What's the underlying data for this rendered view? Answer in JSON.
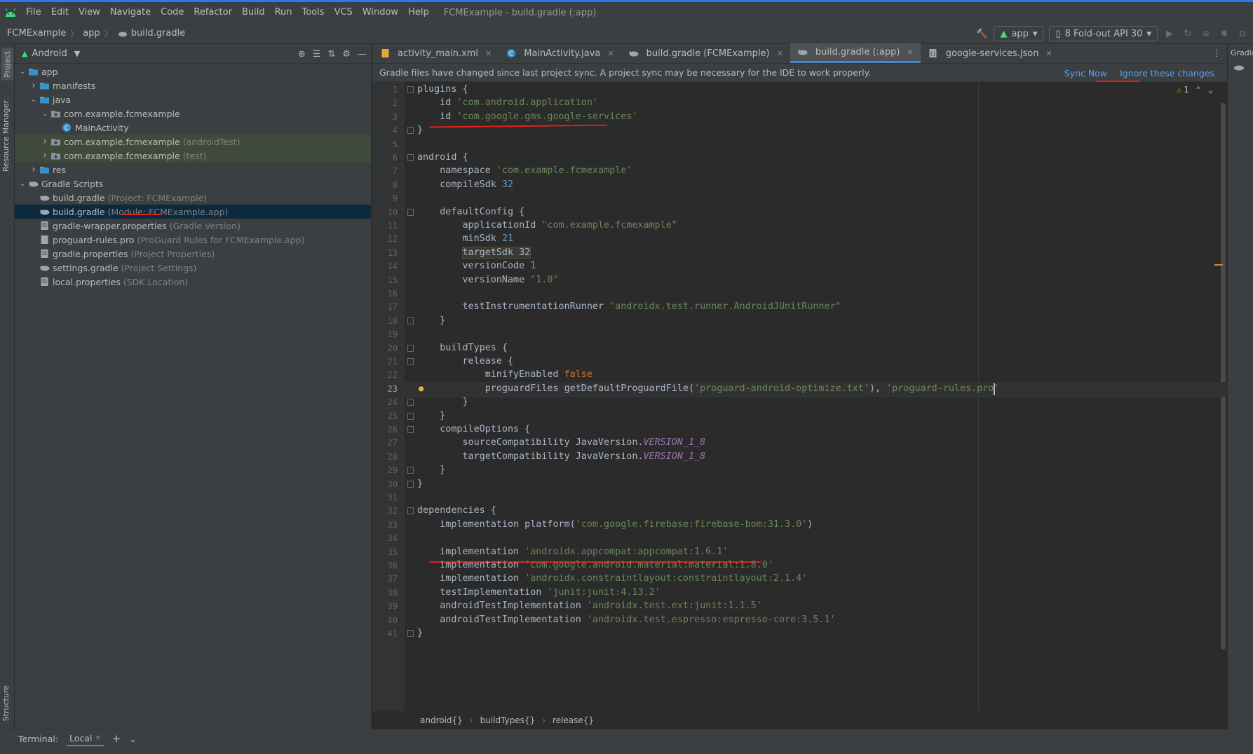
{
  "window": {
    "title": "FCMExample - build.gradle (:app)"
  },
  "menu": [
    "File",
    "Edit",
    "View",
    "Navigate",
    "Code",
    "Refactor",
    "Build",
    "Run",
    "Tools",
    "VCS",
    "Window",
    "Help"
  ],
  "navbar": {
    "crumbs": [
      "FCMExample",
      "app",
      "build.gradle"
    ],
    "run_config": "app",
    "device": "8  Fold-out API 30"
  },
  "side_tabs": {
    "project": "Project",
    "resource_manager": "Resource Manager",
    "structure": "Structure",
    "gradle": "Gradle"
  },
  "project_panel": {
    "view_mode": "Android",
    "tree": [
      {
        "label": "app",
        "hint": "",
        "indent": 0,
        "arrow": "down",
        "icon": "folder-icon"
      },
      {
        "label": "manifests",
        "hint": "",
        "indent": 1,
        "arrow": "right",
        "icon": "folder-icon"
      },
      {
        "label": "java",
        "hint": "",
        "indent": 1,
        "arrow": "down",
        "icon": "folder-icon"
      },
      {
        "label": "com.example.fcmexample",
        "hint": "",
        "indent": 2,
        "arrow": "down",
        "icon": "package-icon"
      },
      {
        "label": "MainActivity",
        "hint": "",
        "indent": 3,
        "arrow": "",
        "icon": "class-icon"
      },
      {
        "label": "com.example.fcmexample",
        "hint": "(androidTest)",
        "indent": 2,
        "arrow": "right",
        "icon": "package-icon"
      },
      {
        "label": "com.example.fcmexample",
        "hint": "(test)",
        "indent": 2,
        "arrow": "right",
        "icon": "package-icon"
      },
      {
        "label": "res",
        "hint": "",
        "indent": 1,
        "arrow": "right",
        "icon": "folder-icon"
      },
      {
        "label": "Gradle Scripts",
        "hint": "",
        "indent": 0,
        "arrow": "down",
        "icon": "gradle-icon"
      },
      {
        "label": "build.gradle",
        "hint": "(Project: FCMExample)",
        "indent": 1,
        "arrow": "",
        "icon": "gradle-icon"
      },
      {
        "label": "build.gradle",
        "hint": "(Module: FCMExample.app)",
        "indent": 1,
        "arrow": "",
        "icon": "gradle-icon"
      },
      {
        "label": "gradle-wrapper.properties",
        "hint": "(Gradle Version)",
        "indent": 1,
        "arrow": "",
        "icon": "properties-icon"
      },
      {
        "label": "proguard-rules.pro",
        "hint": "(ProGuard Rules for FCMExample.app)",
        "indent": 1,
        "arrow": "",
        "icon": "file-icon"
      },
      {
        "label": "gradle.properties",
        "hint": "(Project Properties)",
        "indent": 1,
        "arrow": "",
        "icon": "properties-icon"
      },
      {
        "label": "settings.gradle",
        "hint": "(Project Settings)",
        "indent": 1,
        "arrow": "",
        "icon": "gradle-icon"
      },
      {
        "label": "local.properties",
        "hint": "(SDK Location)",
        "indent": 1,
        "arrow": "",
        "icon": "properties-icon"
      }
    ]
  },
  "editor": {
    "tabs": [
      {
        "label": "activity_main.xml",
        "icon": "xml-icon",
        "active": false
      },
      {
        "label": "MainActivity.java",
        "icon": "class-icon",
        "active": false
      },
      {
        "label": "build.gradle (FCMExample)",
        "icon": "gradle-icon",
        "active": false
      },
      {
        "label": "build.gradle (:app)",
        "icon": "gradle-icon",
        "active": true
      },
      {
        "label": "google-services.json",
        "icon": "json-icon",
        "active": false
      }
    ],
    "banner": {
      "message": "Gradle files have changed since last project sync. A project sync may be necessary for the IDE to work properly.",
      "sync_now": "Sync Now",
      "ignore": "Ignore these changes"
    },
    "warnings_count": "1",
    "current_line": 23,
    "lines": [
      [
        [
          "plugins {",
          "kw"
        ]
      ],
      [
        [
          "    id ",
          "kw"
        ],
        [
          "'com.android.application'",
          "str"
        ]
      ],
      [
        [
          "    id ",
          "kw"
        ],
        [
          "'com.google.gms.google-services'",
          "str"
        ]
      ],
      [
        [
          "}",
          "kw"
        ]
      ],
      [],
      [
        [
          "android {",
          "kw"
        ]
      ],
      [
        [
          "    namespace ",
          "kw"
        ],
        [
          "'com.example.fcmexample'",
          "str"
        ]
      ],
      [
        [
          "    compileSdk ",
          "kw"
        ],
        [
          "32",
          "num"
        ]
      ],
      [],
      [
        [
          "    defaultConfig {",
          "kw"
        ]
      ],
      [
        [
          "        applicationId ",
          "kw"
        ],
        [
          "\"com.example.fcmexample\"",
          "str"
        ]
      ],
      [
        [
          "        minSdk ",
          "kw"
        ],
        [
          "21",
          "num"
        ]
      ],
      [
        [
          "        ",
          "kw"
        ],
        [
          "targetSdk 32",
          "hl"
        ]
      ],
      [
        [
          "        versionCode ",
          "kw"
        ],
        [
          "1",
          "num"
        ]
      ],
      [
        [
          "        versionName ",
          "kw"
        ],
        [
          "\"1.0\"",
          "str"
        ]
      ],
      [],
      [
        [
          "        testInstrumentationRunner ",
          "kw"
        ],
        [
          "\"androidx.test.runner.AndroidJUnitRunner\"",
          "str"
        ]
      ],
      [
        [
          "    }",
          "kw"
        ]
      ],
      [],
      [
        [
          "    buildTypes {",
          "kw"
        ]
      ],
      [
        [
          "        release {",
          "kw"
        ]
      ],
      [
        [
          "            minifyEnabled ",
          "kw"
        ],
        [
          "false",
          "bool"
        ]
      ],
      [
        [
          "            proguardFiles getDefaultProguardFile(",
          "kw"
        ],
        [
          "'proguard-android-optimize.txt'",
          "str"
        ],
        [
          "), ",
          "kw"
        ],
        [
          "'proguard-rules.pro'",
          "str"
        ]
      ],
      [
        [
          "        }",
          "kw"
        ]
      ],
      [
        [
          "    }",
          "kw"
        ]
      ],
      [
        [
          "    compileOptions {",
          "kw"
        ]
      ],
      [
        [
          "        sourceCompatibility JavaVersion.",
          "kw"
        ],
        [
          "VERSION_1_8",
          "stat"
        ]
      ],
      [
        [
          "        targetCompatibility JavaVersion.",
          "kw"
        ],
        [
          "VERSION_1_8",
          "stat"
        ]
      ],
      [
        [
          "    }",
          "kw"
        ]
      ],
      [
        [
          "}",
          "kw"
        ]
      ],
      [],
      [
        [
          "dependencies {",
          "kw"
        ]
      ],
      [
        [
          "    implementation platform(",
          "kw"
        ],
        [
          "'com.google.firebase:firebase-bom:31.3.0'",
          "str"
        ],
        [
          ")",
          "kw"
        ]
      ],
      [],
      [
        [
          "    implementation ",
          "kw"
        ],
        [
          "'androidx.appcompat:appcompat:1.6.1'",
          "str"
        ]
      ],
      [
        [
          "    implementation ",
          "kw"
        ],
        [
          "'com.google.android.material:material:1.8.0'",
          "str"
        ]
      ],
      [
        [
          "    implementation ",
          "kw"
        ],
        [
          "'androidx.constraintlayout:constraintlayout:2.1.4'",
          "str"
        ]
      ],
      [
        [
          "    testImplementation ",
          "kw"
        ],
        [
          "'junit:junit:4.13.2'",
          "str"
        ]
      ],
      [
        [
          "    androidTestImplementation ",
          "kw"
        ],
        [
          "'androidx.test.ext:junit:1.1.5'",
          "str"
        ]
      ],
      [
        [
          "    androidTestImplementation ",
          "kw"
        ],
        [
          "'androidx.test.espresso:espresso-core:3.5.1'",
          "str"
        ]
      ],
      [
        [
          "}",
          "kw"
        ]
      ]
    ],
    "breadcrumb": [
      "android{}",
      "buildTypes{}",
      "release{}"
    ]
  },
  "terminal": {
    "label": "Terminal:",
    "tab": "Local"
  },
  "colors": {
    "accent": "#4a88c7",
    "annotation_red": "#e0201b",
    "link": "#589df6"
  }
}
